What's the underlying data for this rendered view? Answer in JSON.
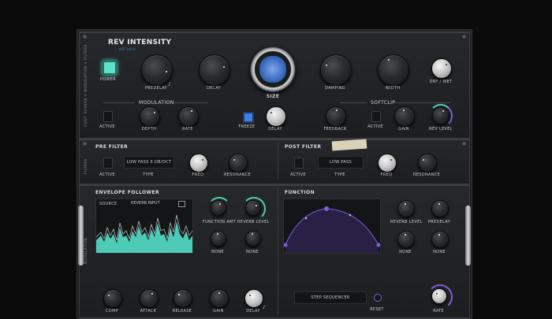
{
  "header": {
    "title": "REV INTENSITY",
    "brand": "ARTURIA",
    "side_label": "CONT. REVERB + MODULATION + FILTERS"
  },
  "top": {
    "power_label": "POWER",
    "knobs": {
      "predelay": "PREDELAY",
      "decay": "DECAY",
      "size": "SIZE",
      "damping": "DAMPING",
      "width": "WIDTH",
      "dry_wet": "DRY / WET"
    },
    "modulation_title": "MODULATION",
    "softclip_title": "SOFTCLIP",
    "mod_active": "ACTIVE",
    "depth": "DEPTH",
    "rate": "RATE",
    "freeze": "FREEZE",
    "delay": "DELAY",
    "feedback": "FEEDBACK",
    "softclip_active": "ACTIVE",
    "gain": "GAIN",
    "rev_level": "REV LEVEL"
  },
  "filters": {
    "side_label": "FILTERS",
    "pre_title": "PRE FILTER",
    "pre_active": "ACTIVE",
    "pre_type_value": "LOW PASS 6 DB/OCT",
    "pre_type": "TYPE",
    "pre_freq": "FREQ",
    "pre_resonance": "RESONANCE",
    "post_title": "POST FILTER",
    "post_active": "ACTIVE",
    "post_type_value": "LOW PASS",
    "post_type": "TYPE",
    "post_freq": "FREQ",
    "post_resonance": "RESONANCE",
    "tape_note": ""
  },
  "bottom": {
    "side_label": "MODULATION",
    "env_title": "ENVELOPE FOLLOWER",
    "source_label": "SOURCE",
    "source_value": "REVERB INPUT",
    "function_amt": "FUNCTION AMT",
    "reverb_level_l": "REVERB LEVEL",
    "none1": "NONE",
    "none2": "NONE",
    "comp": "COMP",
    "attack": "ATTACK",
    "release": "RELEASE",
    "gain": "GAIN",
    "delay": "DELAY",
    "function_title": "FUNCTION",
    "reverb_level_r": "REVERB LEVEL",
    "predelay_r": "PREDELAY",
    "none3": "NONE",
    "none4": "NONE",
    "step_sequencer": "STEP SEQUENCER",
    "reset": "RESET",
    "rate": "RATE"
  },
  "colors": {
    "accent": "#4ecbb7",
    "purple": "#7b5fe0",
    "blue": "#3e7fe0",
    "power": "#5fe3c8"
  }
}
